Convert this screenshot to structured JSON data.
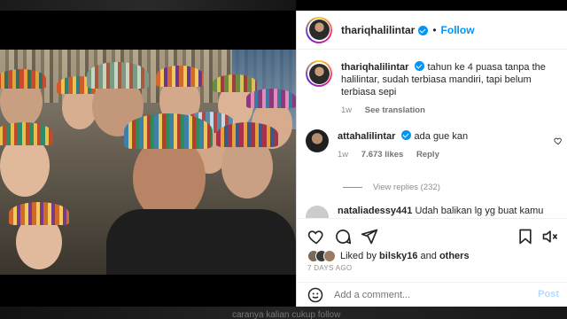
{
  "background": {
    "overlay_caption": "caranya kalian cukup follow"
  },
  "post": {
    "photo_alt": "group photo",
    "author": "thariqhalilintar",
    "separator": "•",
    "follow_label": "Follow",
    "more_label": "•••",
    "caption_text": "tahun ke 4 puasa tanpa the halilintar, sudah terbiasa mandiri, tapi belum terbiasa sepi",
    "caption_time": "1w",
    "see_translation": "See translation"
  },
  "comments": [
    {
      "author": "attahalilintar",
      "text": "ada gue kan",
      "time": "1w",
      "likes": "7.673 likes",
      "reply": "Reply",
      "view_replies": "View replies (232)"
    },
    {
      "author": "nataliadessy441",
      "text": "Udah balikan lg yg buat kamu"
    }
  ],
  "actions": {
    "like_icon": "heart-icon",
    "comment_icon": "comment-icon",
    "share_icon": "share-icon",
    "save_icon": "bookmark-icon"
  },
  "likes": {
    "prefix": "Liked by",
    "user": "bilsky16",
    "and": "and",
    "others": "others"
  },
  "date": "7 DAYS AGO",
  "add_comment": {
    "placeholder": "Add a comment...",
    "post_label": "Post"
  },
  "colors": {
    "accent": "#0095f6",
    "text": "#262626",
    "muted": "#8e8e8e",
    "post_disabled": "#b3dbff"
  }
}
